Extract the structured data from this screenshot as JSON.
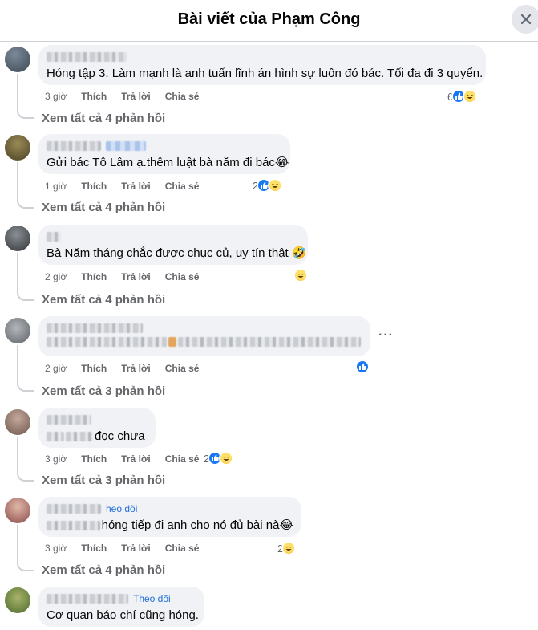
{
  "header": {
    "title": "Bài viết của Phạm Công"
  },
  "icons": {
    "close": "close-icon",
    "like": "like-reaction-icon",
    "haha": "haha-reaction-icon",
    "more": "more-options-icon"
  },
  "colors": {
    "like_blue": "#1877f2",
    "link_blue": "#216fdb",
    "bubble_bg": "#f0f2f5",
    "meta_gray": "#65676b"
  },
  "actions": {
    "like": "Thích",
    "reply": "Trả lời",
    "share": "Chia sẻ"
  },
  "comments": [
    {
      "text": "Hóng tập 3. Làm mạnh là anh tuấn lĩnh án hình sự luôn đó bác. Tối đa đi 3 quyển.",
      "time": "3 giờ",
      "reaction_count": "6",
      "reactions": [
        "like",
        "haha"
      ],
      "see_replies": "Xem tất cả 4 phản hồi"
    },
    {
      "text": "Gửi bác Tô Lâm ạ.thêm luật bà năm đi bác😂",
      "time": "1 giờ",
      "reaction_count": "2",
      "reactions": [
        "like",
        "haha"
      ],
      "see_replies": "Xem tất cả 4 phản hồi"
    },
    {
      "text": "Bà Năm tháng chắc được chục củ, uy tín thật 🤣",
      "time": "2 giờ",
      "reaction_count": "",
      "reactions": [
        "haha"
      ],
      "see_replies": "Xem tất cả 4 phản hồi"
    },
    {
      "text": "",
      "time": "2 giờ",
      "reaction_count": "",
      "reactions": [
        "like"
      ],
      "see_replies": "Xem tất cả 3 phản hồi",
      "more": "···"
    },
    {
      "text": "đọc chưa",
      "time": "3 giờ",
      "reaction_count": "2",
      "reactions": [
        "like",
        "haha"
      ],
      "see_replies": "Xem tất cả 3 phản hồi"
    },
    {
      "follow": "heo dõi",
      "text": "hóng tiếp đi anh cho nó đủ bài nà😂",
      "time": "3 giờ",
      "reaction_count": "2",
      "reactions": [
        "haha"
      ],
      "see_replies": "Xem tất cả 4 phản hồi"
    },
    {
      "follow": "Theo dõi",
      "text": "Cơ quan báo chí cũng hóng."
    }
  ]
}
